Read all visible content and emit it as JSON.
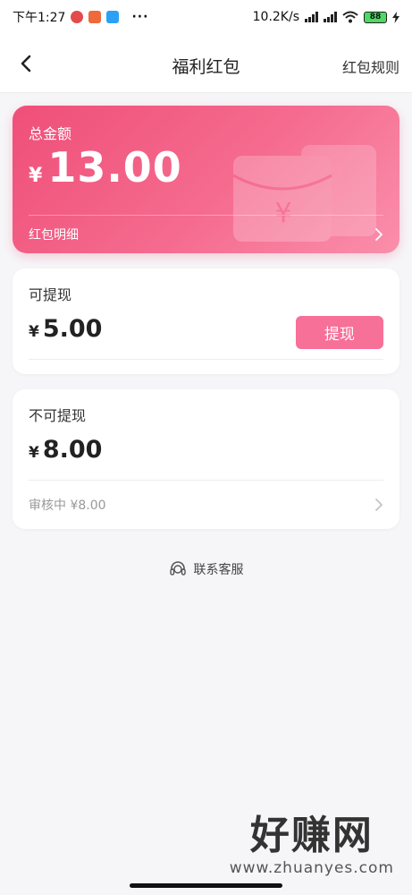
{
  "status_bar": {
    "time": "下午1:27",
    "dots": "···",
    "speed": "10.2K/s",
    "battery": "88"
  },
  "nav": {
    "title": "福利红包",
    "action": "红包规则"
  },
  "total_card": {
    "label": "总金额",
    "currency": "¥",
    "amount": "13.00",
    "detail_label": "红包明细"
  },
  "withdrawable": {
    "title": "可提现",
    "currency": "¥",
    "amount": "5.00",
    "button_label": "提现"
  },
  "non_withdrawable": {
    "title": "不可提现",
    "currency": "¥",
    "amount": "8.00",
    "review_label": "审核中 ¥8.00"
  },
  "contact": {
    "label": "联系客服"
  },
  "watermark": {
    "main": "好赚网",
    "sub": "www.zhuanyes.com"
  },
  "colors": {
    "accent": "#f77098",
    "card_gradient_start": "#ef4f78",
    "card_gradient_end": "#fa8fab"
  }
}
